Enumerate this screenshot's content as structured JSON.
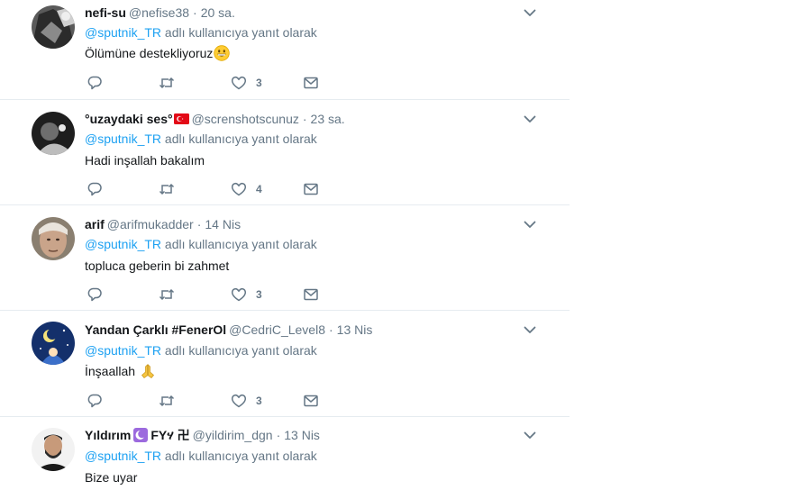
{
  "colors": {
    "link": "#1da1f2",
    "secondary_text": "#657786",
    "primary_text": "#14171a",
    "divider": "#e6ecf0"
  },
  "tweets": [
    {
      "fullname": "nefi-su",
      "username": "@nefise38",
      "time": "20 sa.",
      "reply_to": "@sputnik_TR",
      "reply_suffix": " adlı kullanıcıya yanıt olarak",
      "text": "Ölümüne destekliyoruz",
      "emoji": "grinning-face",
      "like_count": "3",
      "icons": [
        "reply-icon",
        "retweet-icon",
        "heart-icon",
        "message-icon",
        "chevron-down-icon"
      ]
    },
    {
      "fullname": "°uzaydaki ses°",
      "flag": "turkey-flag",
      "username": "@screnshotscunuz",
      "time": "23 sa.",
      "reply_to": "@sputnik_TR",
      "reply_suffix": " adlı kullanıcıya yanıt olarak",
      "text": "Hadi inşallah bakalım",
      "like_count": "4"
    },
    {
      "fullname": "arif",
      "username": "@arifmukadder",
      "time": "14 Nis",
      "reply_to": "@sputnik_TR",
      "reply_suffix": " adlı kullanıcıya yanıt olarak",
      "text": "topluca geberin bi zahmet",
      "like_count": "3"
    },
    {
      "fullname": "Yandan Çarklı #FenerOl",
      "username": "@CedriC_Level8",
      "time": "13 Nis",
      "reply_to": "@sputnik_TR",
      "reply_suffix": " adlı kullanıcıya yanıt olarak",
      "text": "İnşaallah",
      "emoji": "folded-hands",
      "like_count": "3"
    },
    {
      "fullname": "Yıldırım",
      "badge": "crescent-moon",
      "fullname_suffix": "FYሃ 卍",
      "username": "@yildirim_dgn",
      "time": "13 Nis",
      "reply_to": "@sputnik_TR",
      "reply_suffix": " adlı kullanıcıya yanıt olarak",
      "text": "Bize uyar"
    }
  ],
  "separator": "·"
}
